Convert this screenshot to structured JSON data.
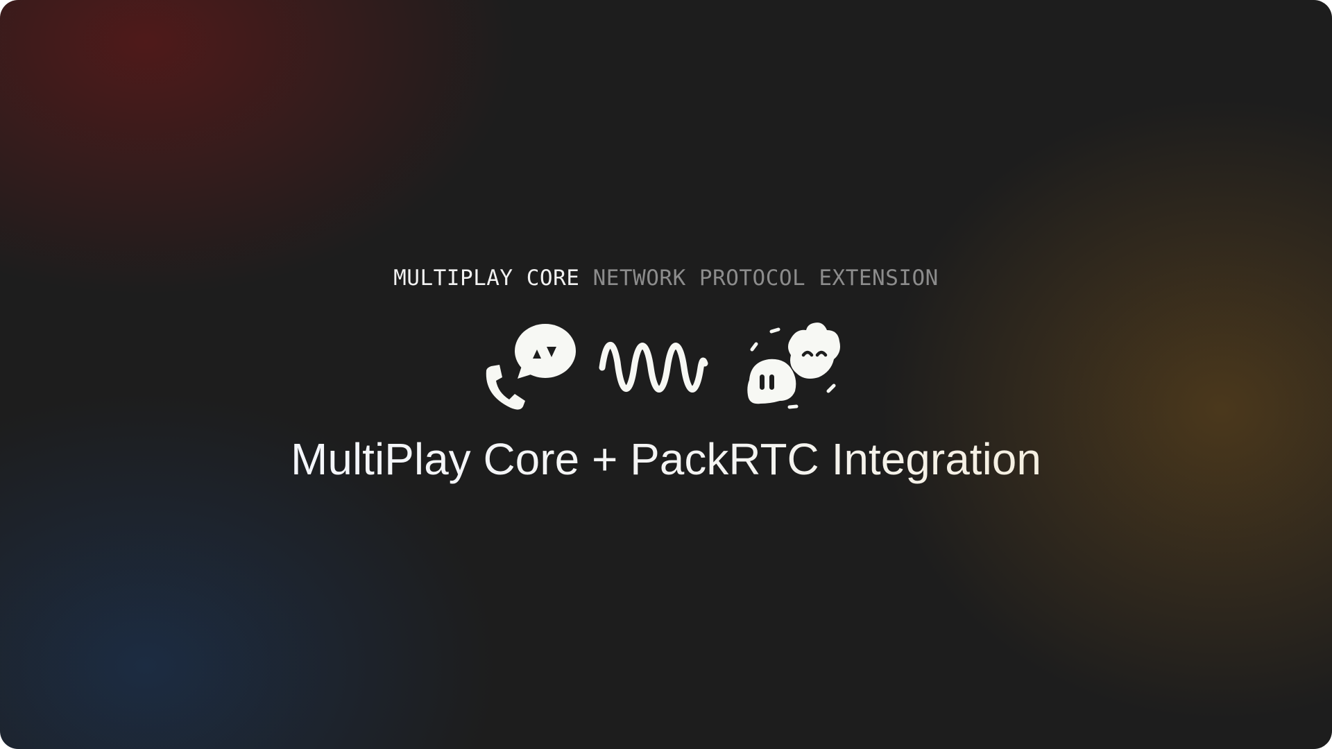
{
  "header": {
    "eyebrow_primary": "MULTIPLAY CORE",
    "eyebrow_secondary": "NETWORK PROTOCOL EXTENSION"
  },
  "icons": [
    "phone-chat-icon",
    "wave-icon",
    "blob-friends-icon"
  ],
  "main": {
    "title": "MultiPlay Core + PackRTC Integration"
  },
  "colors": {
    "background": "#1d1d1d",
    "glow_red": "#781818",
    "glow_blue": "#1c3860",
    "glow_amber": "#704e1c",
    "text_primary": "#f4f4f0",
    "text_secondary": "#8c8c8c",
    "icon_fill": "#f7f8f4"
  }
}
